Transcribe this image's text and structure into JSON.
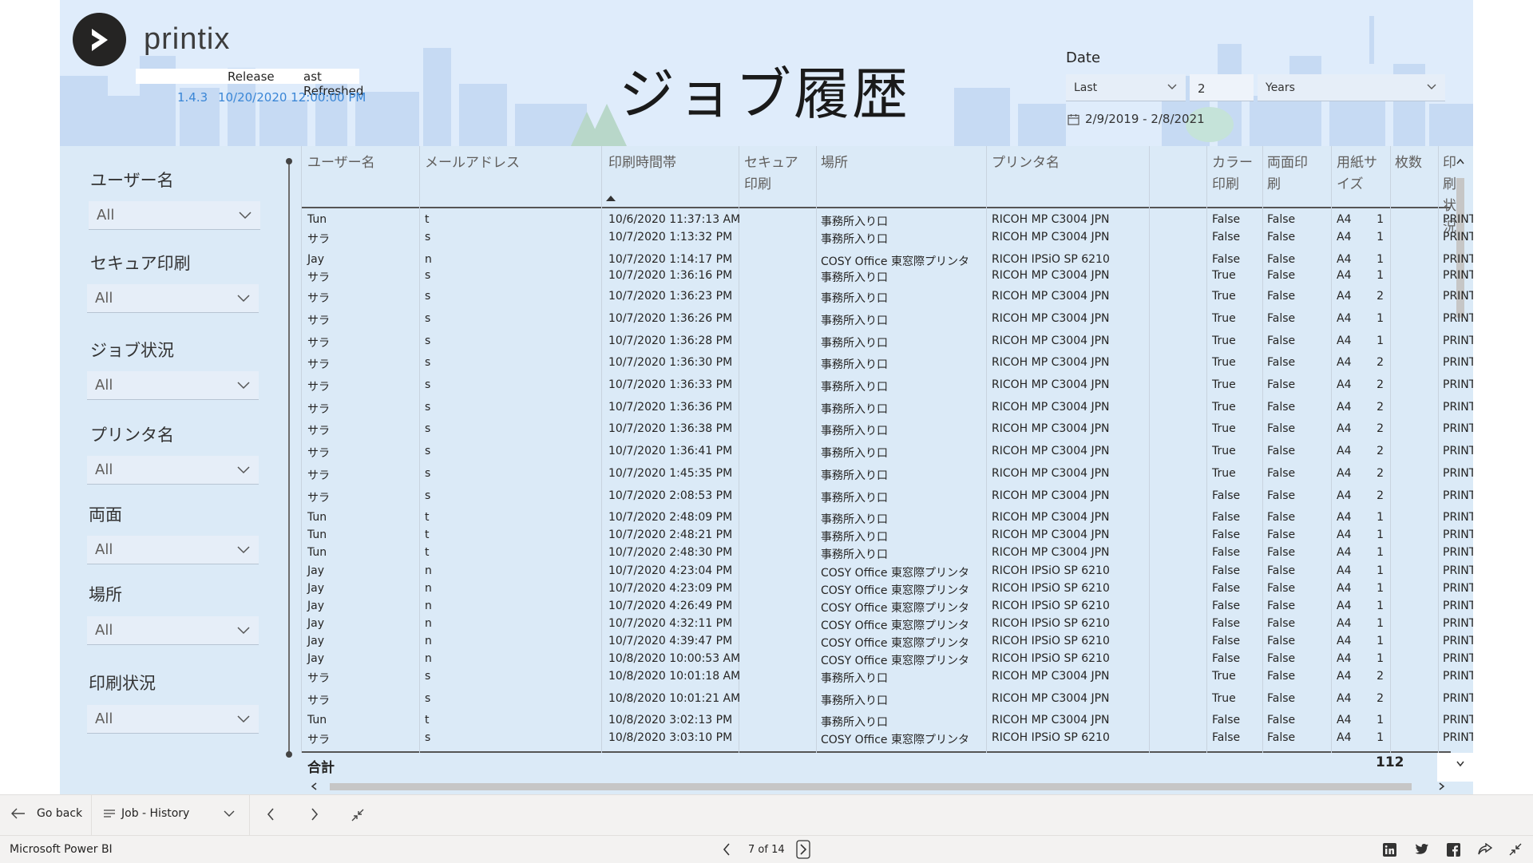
{
  "header": {
    "brand": "printix",
    "release_label": "Release",
    "refreshed_label": "ast Refreshed",
    "version": "1.4.3",
    "refreshed_value": "10/20/2020 12:00:00 PM",
    "title": "ジョブ履歴"
  },
  "date_filter": {
    "label": "Date",
    "period": "Last",
    "count": "2",
    "unit": "Years",
    "range": "2/9/2019 - 2/8/2021"
  },
  "slicers": [
    {
      "label": "ユーザー名",
      "value": "All"
    },
    {
      "label": "セキュア印刷",
      "value": "All"
    },
    {
      "label": "ジョブ状況",
      "value": "All"
    },
    {
      "label": "プリンタ名",
      "value": "All"
    },
    {
      "label": "両面",
      "value": "All"
    },
    {
      "label": "場所",
      "value": "All"
    },
    {
      "label": "印刷状況",
      "value": "All"
    }
  ],
  "table": {
    "columns": [
      [
        "ユーザー名"
      ],
      [
        "メールアドレス"
      ],
      [
        "印刷時間帯"
      ],
      [
        "セキュア",
        "印刷"
      ],
      [
        "場所"
      ],
      [
        "プリンタ名"
      ],
      [
        "カラー",
        "印刷"
      ],
      [
        "両面印",
        "刷"
      ],
      [
        "用紙サ",
        "イズ"
      ],
      [
        "枚数"
      ],
      [
        "印刷状況"
      ]
    ],
    "rows": [
      [
        "Tun",
        "t",
        "10/6/2020 11:37:13 AM",
        "",
        "事務所入り口",
        "RICOH MP C3004 JPN",
        "False",
        "False",
        "A4",
        "1",
        "PRINT_OK"
      ],
      [
        "サラ",
        "s",
        "10/7/2020 1:13:32 PM",
        "",
        "事務所入り口",
        "RICOH MP C3004 JPN",
        "False",
        "False",
        "A4",
        "1",
        "PRINT_OK"
      ],
      [
        "Jay",
        "n",
        "10/7/2020 1:14:17 PM",
        "",
        "COSY Office 東窓際プリンタ",
        "RICOH IPSiO SP 6210",
        "False",
        "False",
        "A4",
        "1",
        "PRINT_FAILE"
      ],
      [
        "サラ",
        "s",
        "10/7/2020 1:36:16 PM",
        "",
        "事務所入り口",
        "RICOH MP C3004 JPN",
        "True",
        "False",
        "A4",
        "1",
        "PRINT_OK"
      ],
      [
        "サラ",
        "s",
        "10/7/2020 1:36:23 PM",
        "",
        "事務所入り口",
        "RICOH MP C3004 JPN",
        "True",
        "False",
        "A4",
        "2",
        "PRINT_OK"
      ],
      [
        "サラ",
        "s",
        "10/7/2020 1:36:26 PM",
        "",
        "事務所入り口",
        "RICOH MP C3004 JPN",
        "True",
        "False",
        "A4",
        "1",
        "PRINT_OK"
      ],
      [
        "サラ",
        "s",
        "10/7/2020 1:36:28 PM",
        "",
        "事務所入り口",
        "RICOH MP C3004 JPN",
        "True",
        "False",
        "A4",
        "1",
        "PRINT_OK"
      ],
      [
        "サラ",
        "s",
        "10/7/2020 1:36:30 PM",
        "",
        "事務所入り口",
        "RICOH MP C3004 JPN",
        "True",
        "False",
        "A4",
        "2",
        "PRINT_OK"
      ],
      [
        "サラ",
        "s",
        "10/7/2020 1:36:33 PM",
        "",
        "事務所入り口",
        "RICOH MP C3004 JPN",
        "True",
        "False",
        "A4",
        "2",
        "PRINT_OK"
      ],
      [
        "サラ",
        "s",
        "10/7/2020 1:36:36 PM",
        "",
        "事務所入り口",
        "RICOH MP C3004 JPN",
        "True",
        "False",
        "A4",
        "2",
        "PRINT_OK"
      ],
      [
        "サラ",
        "s",
        "10/7/2020 1:36:38 PM",
        "",
        "事務所入り口",
        "RICOH MP C3004 JPN",
        "True",
        "False",
        "A4",
        "2",
        "PRINT_OK"
      ],
      [
        "サラ",
        "s",
        "10/7/2020 1:36:41 PM",
        "",
        "事務所入り口",
        "RICOH MP C3004 JPN",
        "True",
        "False",
        "A4",
        "2",
        "PRINT_OK"
      ],
      [
        "サラ",
        "s",
        "10/7/2020 1:45:35 PM",
        "",
        "事務所入り口",
        "RICOH MP C3004 JPN",
        "True",
        "False",
        "A4",
        "2",
        "PRINT_OK"
      ],
      [
        "サラ",
        "s",
        "10/7/2020 2:08:53 PM",
        "",
        "事務所入り口",
        "RICOH MP C3004 JPN",
        "False",
        "False",
        "A4",
        "2",
        "PRINT_OK"
      ],
      [
        "Tun",
        "t",
        "10/7/2020 2:48:09 PM",
        "",
        "事務所入り口",
        "RICOH MP C3004 JPN",
        "False",
        "False",
        "A4",
        "1",
        "PRINT_OK"
      ],
      [
        "Tun",
        "t",
        "10/7/2020 2:48:21 PM",
        "",
        "事務所入り口",
        "RICOH MP C3004 JPN",
        "False",
        "False",
        "A4",
        "1",
        "PRINT_OK"
      ],
      [
        "Tun",
        "t",
        "10/7/2020 2:48:30 PM",
        "",
        "事務所入り口",
        "RICOH MP C3004 JPN",
        "False",
        "False",
        "A4",
        "1",
        "PRINT_OK"
      ],
      [
        "Jay",
        "n",
        "10/7/2020 4:23:04 PM",
        "",
        "COSY Office 東窓際プリンタ",
        "RICOH IPSiO SP 6210",
        "False",
        "False",
        "A4",
        "1",
        "PRINT_OK"
      ],
      [
        "Jay",
        "n",
        "10/7/2020 4:23:09 PM",
        "",
        "COSY Office 東窓際プリンタ",
        "RICOH IPSiO SP 6210",
        "False",
        "False",
        "A4",
        "1",
        "PRINT_OK"
      ],
      [
        "Jay",
        "n",
        "10/7/2020 4:26:49 PM",
        "",
        "COSY Office 東窓際プリンタ",
        "RICOH IPSiO SP 6210",
        "False",
        "False",
        "A4",
        "1",
        "PRINT_OK"
      ],
      [
        "Jay",
        "n",
        "10/7/2020 4:32:11 PM",
        "",
        "COSY Office 東窓際プリンタ",
        "RICOH IPSiO SP 6210",
        "False",
        "False",
        "A4",
        "1",
        "PRINT_OK"
      ],
      [
        "Jay",
        "n",
        "10/7/2020 4:39:47 PM",
        "",
        "COSY Office 東窓際プリンタ",
        "RICOH IPSiO SP 6210",
        "False",
        "False",
        "A4",
        "1",
        "PRINT_OK"
      ],
      [
        "Jay",
        "n",
        "10/8/2020 10:00:53 AM",
        "",
        "COSY Office 東窓際プリンタ",
        "RICOH IPSiO SP 6210",
        "False",
        "False",
        "A4",
        "1",
        "PRINT_OK"
      ],
      [
        "サラ",
        "s",
        "10/8/2020 10:01:18 AM",
        "",
        "事務所入り口",
        "RICOH MP C3004 JPN",
        "True",
        "False",
        "A4",
        "2",
        "PRINT_OK"
      ],
      [
        "サラ",
        "s",
        "10/8/2020 10:01:21 AM",
        "",
        "事務所入り口",
        "RICOH MP C3004 JPN",
        "True",
        "False",
        "A4",
        "2",
        "PRINT_OK"
      ],
      [
        "Tun",
        "t",
        "10/8/2020 3:02:13 PM",
        "",
        "事務所入り口",
        "RICOH MP C3004 JPN",
        "False",
        "False",
        "A4",
        "1",
        "PRINT_OK"
      ],
      [
        "サラ",
        "s",
        "10/8/2020 3:03:10 PM",
        "",
        "COSY Office 東窓際プリンタ",
        "RICOH IPSiO SP 6210",
        "False",
        "False",
        "A4",
        "1",
        "PRINT_OK"
      ]
    ],
    "total_label": "合計",
    "total_value": "112"
  },
  "navbar": {
    "back_label": "Go back",
    "page_name": "Job - History"
  },
  "statusbar": {
    "brand": "Microsoft Power BI",
    "page_indicator": "7 of 14"
  },
  "icons": {
    "share": [
      "linkedin-icon",
      "twitter-icon",
      "facebook-icon",
      "share-icon",
      "collapse-icon"
    ]
  },
  "colors": {
    "report_bg": "#dbeaf7",
    "accent_link": "#3a86d6",
    "logo": "#252423"
  }
}
